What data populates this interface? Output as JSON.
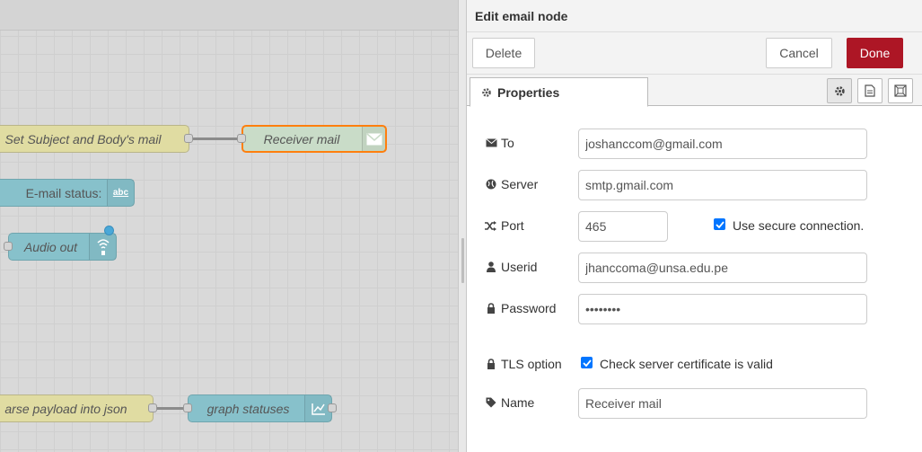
{
  "canvas": {
    "nodes": {
      "set_subject": "Set Subject and Body's mail",
      "receiver": "Receiver mail",
      "email_status": "E-mail status:",
      "audio_out": "Audio out",
      "parse_json": "arse payload into json",
      "graph_statuses": "graph statuses"
    },
    "colors": {
      "function_node": "#e0dca2",
      "email_node": "#c9dcc8",
      "teal_node": "#87c1cb",
      "selected_border": "#ff7f0e"
    }
  },
  "tray": {
    "title": "Edit email node",
    "buttons": {
      "delete": "Delete",
      "cancel": "Cancel",
      "done": "Done"
    },
    "tabs": {
      "properties": "Properties"
    },
    "form": {
      "to": {
        "label": "To",
        "value": "joshanccom@gmail.com"
      },
      "server": {
        "label": "Server",
        "value": "smtp.gmail.com"
      },
      "port": {
        "label": "Port",
        "value": "465",
        "secure_label": "Use secure connection.",
        "secure_checked": true
      },
      "userid": {
        "label": "Userid",
        "value": "jhanccoma@unsa.edu.pe"
      },
      "password": {
        "label": "Password",
        "value": "••••••••"
      },
      "tls": {
        "label": "TLS option",
        "check_label": "Check server certificate is valid",
        "checked": true
      },
      "name": {
        "label": "Name",
        "value": "Receiver mail"
      }
    },
    "colors": {
      "done_button": "#ad1625",
      "checkbox": "#0075ff"
    }
  }
}
